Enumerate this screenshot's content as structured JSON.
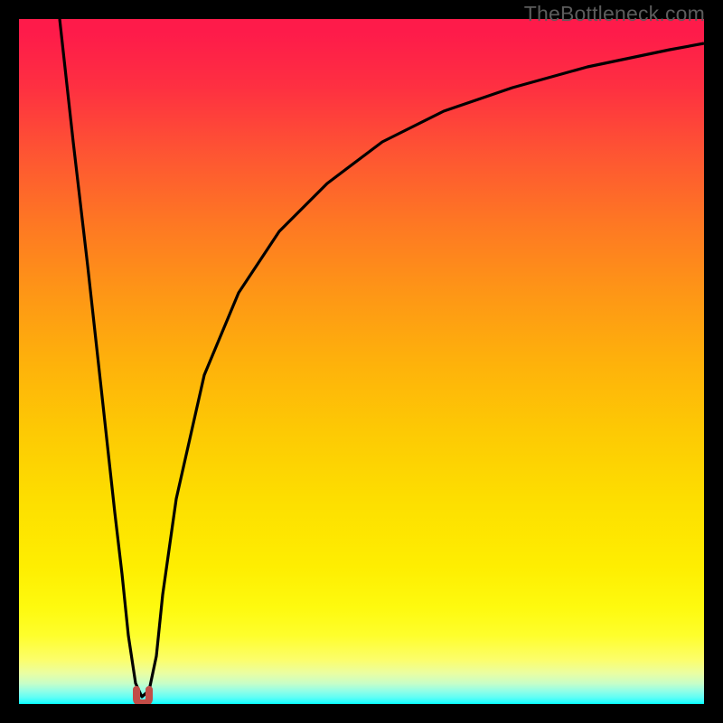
{
  "watermark": "TheBottleneck.com",
  "colors": {
    "page_bg": "#000000",
    "gradient_top": "#fe1b4a",
    "gradient_bottom": "#01fefe",
    "curve": "#000000",
    "dip_marker": "#c24c47"
  },
  "chart_data": {
    "type": "line",
    "title": "",
    "xlabel": "",
    "ylabel": "",
    "xlim": [
      0,
      100
    ],
    "ylim": [
      0,
      100
    ],
    "grid": false,
    "legend": false,
    "series": [
      {
        "name": "bottleneck-curve",
        "x": [
          6,
          8,
          10,
          12,
          14,
          15,
          16,
          17,
          18,
          19,
          20,
          21,
          23,
          27,
          32,
          38,
          45,
          53,
          62,
          72,
          83,
          95,
          100
        ],
        "values": [
          100,
          82,
          64,
          46,
          28,
          19,
          10,
          3,
          1,
          2,
          7,
          16,
          30,
          48,
          60,
          69,
          76,
          82,
          86.5,
          90,
          93,
          95.5,
          96.5
        ]
      }
    ],
    "annotations": [
      {
        "name": "dip",
        "x": 18,
        "y": 0.5
      }
    ],
    "notes": "Background is a vertical heat gradient from red (top, high mismatch) through yellow to cyan-green (bottom, optimal). The black curve descends sharply from upper-left, reaches ~0 around x≈18, then rises and asymptotes toward ~96 at the right edge. The small red 'u' marker at the dip indicates the optimum."
  }
}
